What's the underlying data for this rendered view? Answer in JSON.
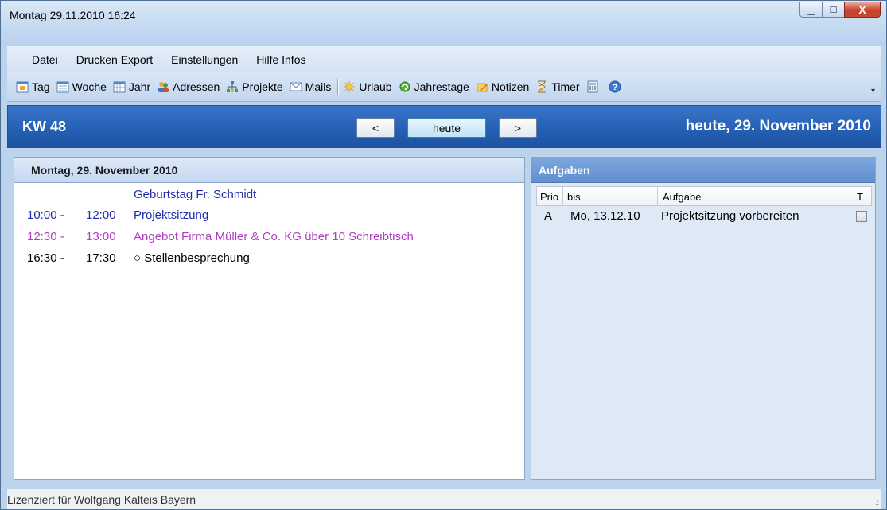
{
  "window": {
    "title": "Montag  29.11.2010  16:24",
    "minimize_glyph": "▁",
    "maximize_glyph": "☐",
    "close_glyph": "X"
  },
  "menu": [
    "Datei",
    "Drucken Export",
    "Einstellungen",
    "Hilfe Infos"
  ],
  "toolbar": {
    "items": [
      {
        "label": "Tag",
        "icon": "calendar-day-icon"
      },
      {
        "label": "Woche",
        "icon": "calendar-week-icon"
      },
      {
        "label": "Jahr",
        "icon": "calendar-year-icon"
      },
      {
        "label": "Adressen",
        "icon": "contacts-icon"
      },
      {
        "label": "Projekte",
        "icon": "projects-icon"
      },
      {
        "label": "Mails",
        "icon": "mail-icon"
      },
      {
        "label": "Urlaub",
        "icon": "sun-icon"
      },
      {
        "label": "Jahrestage",
        "icon": "anniversary-icon"
      },
      {
        "label": "Notizen",
        "icon": "notes-icon"
      },
      {
        "label": "Timer",
        "icon": "hourglass-icon"
      }
    ],
    "calculator_icon": "calculator-icon",
    "help_icon": "help-icon",
    "overflow_glyph": "▾"
  },
  "week": {
    "label": "KW 48",
    "prev": "<",
    "today_button": "heute",
    "next": ">",
    "today_text": "heute,   29. November 2010"
  },
  "day": {
    "header": "Montag, 29. November 2010",
    "appointments": [
      {
        "start": "",
        "end": "",
        "subject": "Geburtstag Fr. Schmidt",
        "color": "#1f2cb0"
      },
      {
        "start": "10:00 -",
        "end": "12:00",
        "subject": "Projektsitzung",
        "color": "#1f2cb0"
      },
      {
        "start": "12:30 -",
        "end": "13:00",
        "subject": "Angebot Firma Müller & Co. KG über 10 Schreibtisch",
        "color": "#b23bc6"
      },
      {
        "start": "16:30 -",
        "end": "17:30",
        "subject": "○ Stellenbesprechung",
        "color": "#000000"
      }
    ]
  },
  "tasks": {
    "header": "Aufgaben",
    "columns": [
      "Prio",
      "bis",
      "Aufgabe",
      "T"
    ],
    "rows": [
      {
        "prio": "A",
        "bis": "Mo, 13.12.10",
        "aufgabe": "Projektsitzung vorbereiten",
        "done": false
      }
    ]
  },
  "status": {
    "text": "Lizenziert für Wolfgang Kalteis  Bayern",
    "grip": ".:"
  },
  "colors": {
    "week_bar": "#2561b6",
    "appointment_blue": "#1f2cb0",
    "appointment_purple": "#b23bc6"
  }
}
